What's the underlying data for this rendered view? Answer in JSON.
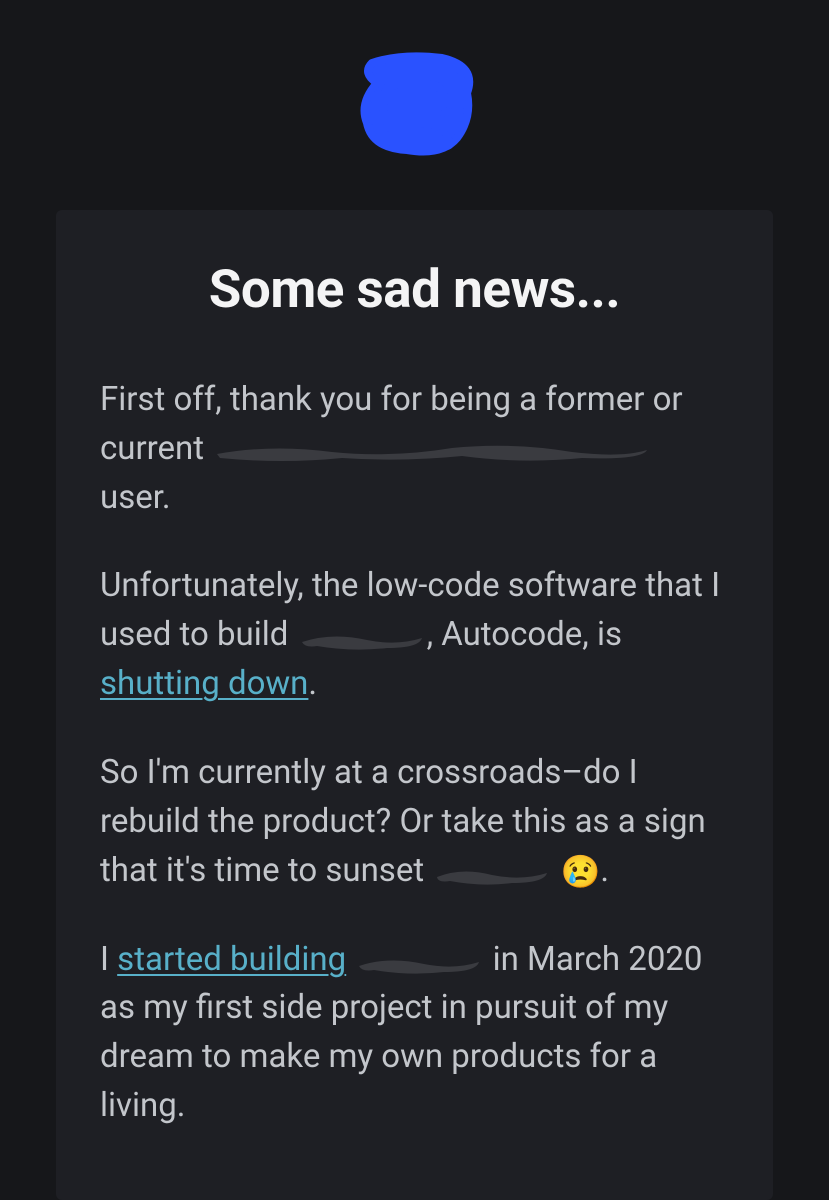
{
  "title": "Some sad news...",
  "p1": {
    "a": "First off, thank you for being a former or current ",
    "b": " user."
  },
  "p2": {
    "a": "Unfortunately, the low-code software that I used to build ",
    "b": ", Autocode, is ",
    "link": "shutting down",
    "c": "."
  },
  "p3": {
    "a": "So I'm currently at a crossroads–do I rebuild the product? Or take this as a sign that it's time to sunset ",
    "emoji": "😢",
    "b": "."
  },
  "p4": {
    "a": "I ",
    "link": "started building",
    "b": " ",
    "c": "in March 2020 as my first side project in pursuit of my dream to make my own products for a living."
  }
}
